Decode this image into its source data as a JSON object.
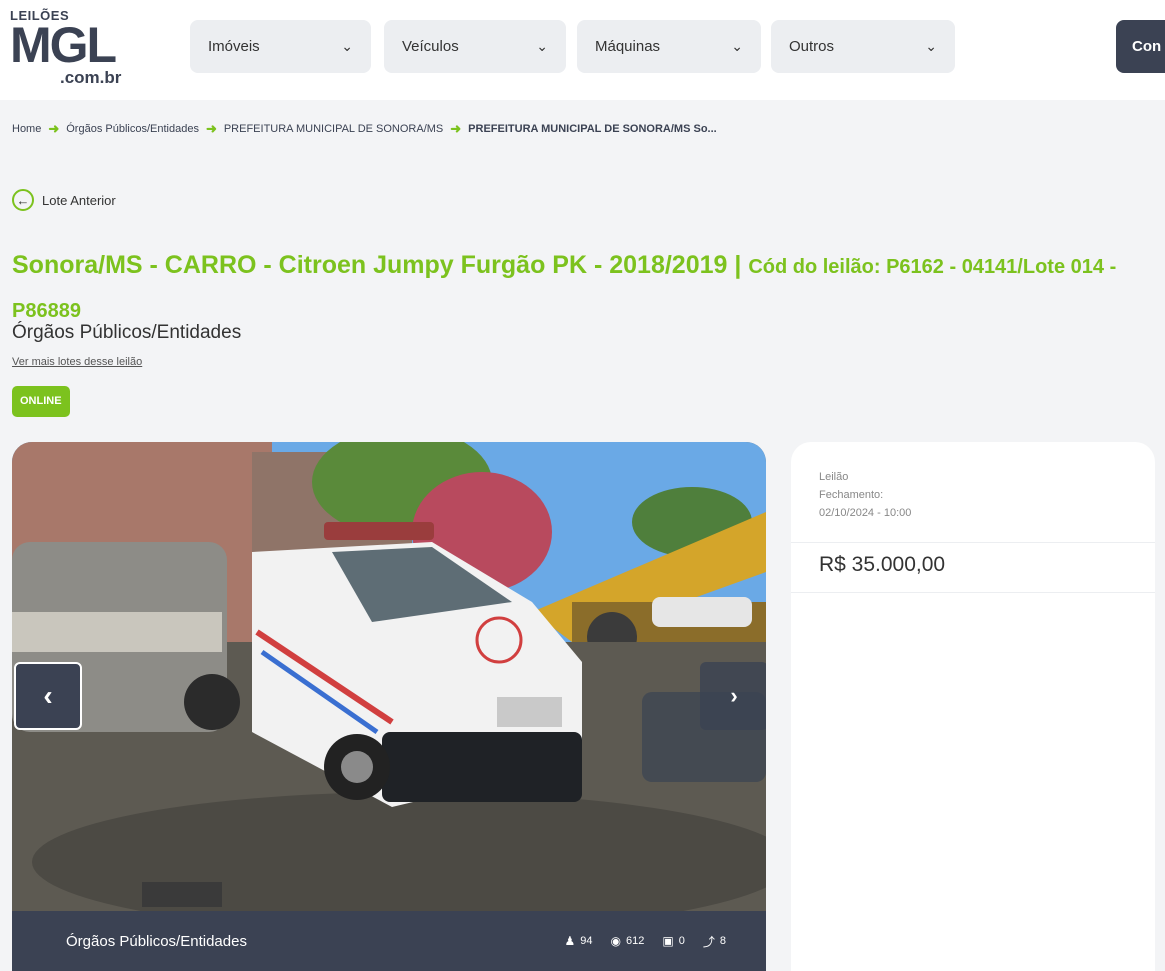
{
  "header": {
    "logo_top": "LEILÕES",
    "logo_main": "MGL",
    "logo_sub": ".com.br",
    "nav": [
      {
        "label": "Imóveis"
      },
      {
        "label": "Veículos"
      },
      {
        "label": "Máquinas"
      },
      {
        "label": "Outros"
      }
    ],
    "cta_label": "Con"
  },
  "breadcrumb": [
    "Home",
    "Órgãos Públicos/Entidades",
    "PREFEITURA MUNICIPAL DE SONORA/MS",
    "PREFEITURA MUNICIPAL DE SONORA/MS So..."
  ],
  "prev_lot_label": "Lote Anterior",
  "lot": {
    "title": "Sonora/MS - CARRO - Citroen Jumpy Furgão PK - 2018/2019 |",
    "code": "Cód do leilão: P6162 - 04141/Lote 014 - P86889",
    "category": "Órgãos Públicos/Entidades",
    "more_link": "Ver mais lotes desse leilão",
    "status": "ONLINE"
  },
  "photo": {
    "footer_label": "Órgãos Públicos/Entidades",
    "stats": {
      "users": "94",
      "views": "612",
      "saved": "0",
      "bids": "8"
    }
  },
  "auction": {
    "type_label": "Leilão",
    "closing_label": "Fechamento:",
    "closing_date": "02/10/2024 - 10:00",
    "price": "R$ 35.000,00"
  },
  "colors": {
    "accent": "#7cc21e",
    "dark": "#3b4253"
  }
}
